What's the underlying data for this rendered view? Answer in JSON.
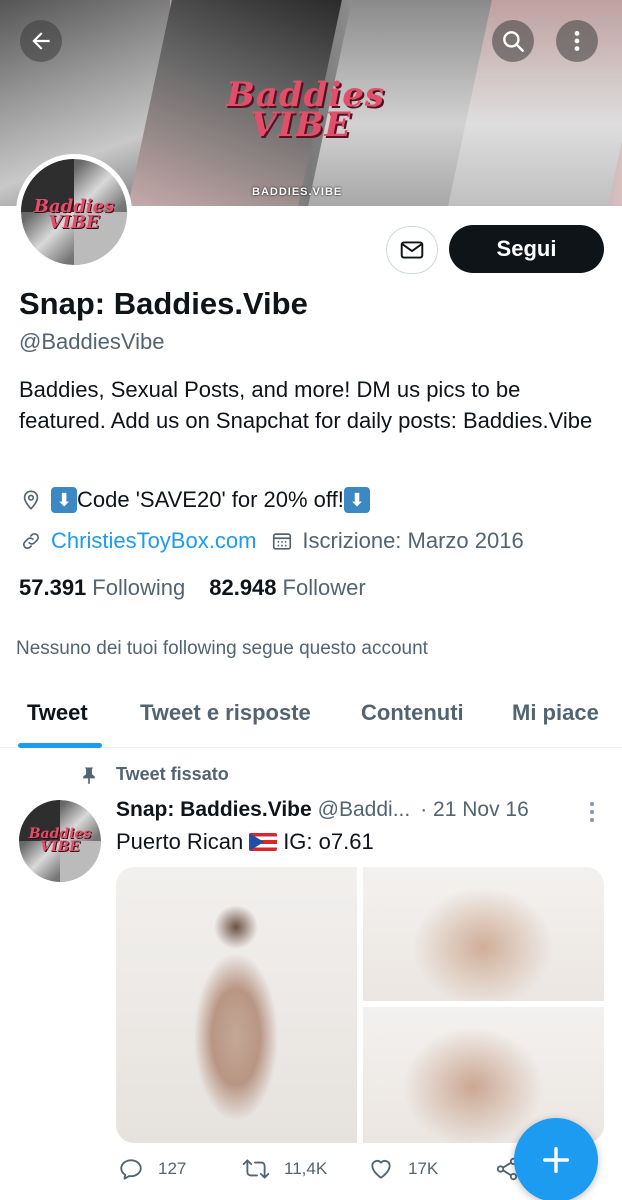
{
  "banner": {
    "logo_text": "Baddies VIBE",
    "tag_text": "BADDIES.VIBE"
  },
  "avatar": {
    "logo_text": "Baddies VIBE"
  },
  "profile": {
    "name": "Snap: Baddies.Vibe",
    "handle": "@BaddiesVibe",
    "bio": "Baddies, Sexual Posts, and more! DM us pics to be featured. Add us on Snapchat for daily posts: Baddies.Vibe",
    "location_text": "Code 'SAVE20' for 20% off!",
    "location_prefix_emoji": "⬇",
    "location_suffix_emoji": "⬇",
    "website": "ChristiesToyBox.com",
    "joined": "Iscrizione: Marzo 2016",
    "following_count": "57.391",
    "following_label": "Following",
    "followers_count": "82.948",
    "followers_label": "Follower",
    "follow_button": "Segui",
    "no_mutuals": "Nessuno dei tuoi following segue questo account"
  },
  "tabs": [
    {
      "label": "Tweet",
      "active": true
    },
    {
      "label": "Tweet e risposte",
      "active": false
    },
    {
      "label": "Contenuti",
      "active": false
    },
    {
      "label": "Mi piace",
      "active": false
    }
  ],
  "tweet": {
    "pinned_label": "Tweet fissato",
    "author_name": "Snap: Baddies.Vibe",
    "author_handle": "@Baddi...",
    "date": "· 21 Nov 16",
    "text_before_flag": "Puerto Rican",
    "text_after_flag": "IG: o7.61",
    "replies": "127",
    "retweets": "11,4K",
    "likes": "17K"
  },
  "colors": {
    "accent": "#1d9bf0",
    "text_primary": "#0f1419",
    "text_secondary": "#536471",
    "follow_button_bg": "#0f1419"
  },
  "icons": {
    "back": "arrow-left-icon",
    "search": "search-icon",
    "more": "more-vertical-icon",
    "message": "mail-icon",
    "location": "location-pin-icon",
    "link": "link-icon",
    "calendar": "calendar-icon",
    "pin": "pin-icon",
    "reply": "reply-icon",
    "retweet": "retweet-icon",
    "like": "heart-icon",
    "share": "share-icon",
    "compose": "plus-icon"
  }
}
